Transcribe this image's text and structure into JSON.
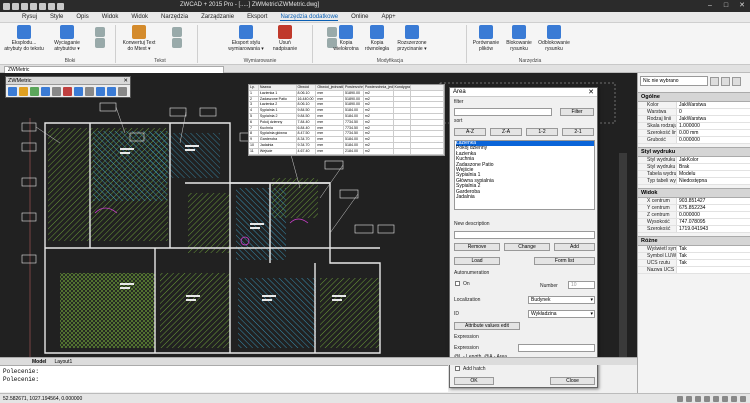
{
  "title_bar": {
    "text": "ZWCAD + 2015 Pro - [.....] ZWMetric\\ZWMetric.dwg]"
  },
  "menu": [
    "Rysuj",
    "Style",
    "Opis",
    "Widok",
    "Widok",
    "Narzędzia",
    "Zarządzanie",
    "Eksport",
    "Narzędzia dodatkowe",
    "Online",
    "App+"
  ],
  "menu_active_index": 8,
  "ribbon": {
    "buttons": [
      {
        "label": "Eksplodu...\natrybuty do tekstu",
        "color": "#3a7bd5"
      },
      {
        "label": "Wyciąganie\natrybutów ▾",
        "color": "#3a7bd5"
      },
      {
        "label": "Konwertuj Text\ndo Mtext ▾",
        "color": "#d48b2c"
      },
      {
        "label": "Eksport stylu\nwymiarowania ▾",
        "color": "#3a7bd5"
      },
      {
        "label": "Usuń\nnadpisanie",
        "color": "#c0392b"
      },
      {
        "label": "Kopia\nwielokrotna",
        "color": "#3a7bd5"
      },
      {
        "label": "Kopia\nrównoległa",
        "color": "#3a7bd5"
      },
      {
        "label": "Rozszerzone\nprzycinanie ▾",
        "color": "#3a7bd5"
      },
      {
        "label": "Porównanie\nplików",
        "color": "#3a7bd5"
      },
      {
        "label": "Blokowanie\nrysunku",
        "color": "#3a7bd5"
      },
      {
        "label": "Odblokowanie\nrysunku",
        "color": "#3a7bd5"
      }
    ],
    "groups": [
      "Bloki",
      "Tekst",
      "Wymiarowanie",
      "Modyfikacja",
      "Narzędzia"
    ]
  },
  "doc_tab": "ZWMetric",
  "zwmetric_title": "ZWMetric",
  "layout_tabs": [
    "Model",
    "Layout1"
  ],
  "command_line": [
    "Polecenie:",
    "Polecenie:"
  ],
  "status_coords": "52.582671,  1027.194564, 0.000000",
  "table": {
    "header": [
      "Lp.",
      "Nazwa",
      "Obwód",
      "Obwód_jednostki",
      "Powierzchnia",
      "Powierzchnia_jednostki",
      "Kondygnacja"
    ],
    "rows": [
      [
        "1",
        "Łazienka 1",
        "8.06.10",
        "mm",
        "51890.00",
        "m2"
      ],
      [
        "2",
        "Zadaszone Patio",
        "16.440.00",
        "mm",
        "51890.00",
        "m2"
      ],
      [
        "3",
        "Łazienka 2",
        "8.06.10",
        "mm",
        "51890.00",
        "m2"
      ],
      [
        "4",
        "Sypialnia 1",
        "9.84.50",
        "mm",
        "5184.00",
        "m2"
      ],
      [
        "5",
        "Sypialnia 2",
        "9.84.50",
        "mm",
        "5184.00",
        "m2"
      ],
      [
        "6",
        "Pokój dzienny",
        "7.84.40",
        "mm",
        "7734.50",
        "m2"
      ],
      [
        "7",
        "Kuchnia",
        "6.84.40",
        "mm",
        "7734.50",
        "m2"
      ],
      [
        "8",
        "Sypialnia główna",
        "8.47.50",
        "mm",
        "7734.50",
        "m2"
      ],
      [
        "9",
        "Garderoba",
        "8.34.70",
        "mm",
        "5184.00",
        "m2"
      ],
      [
        "10",
        "Jadalnia",
        "9.34.70",
        "mm",
        "5184.00",
        "m2"
      ],
      [
        "11",
        "Wejście",
        "4.67.40",
        "mm",
        "2184.00",
        "m2"
      ],
      [
        "12",
        "Korytarz",
        "6.96.00",
        "mm",
        "2184.00",
        "m2"
      ]
    ]
  },
  "area_dialog": {
    "title": "Area",
    "filter_label": "filter",
    "filter_button": "Filter",
    "sort_label": "sort",
    "sort_buttons": [
      "A-Z",
      "Z-A",
      "1-2",
      "2-1"
    ],
    "rooms": [
      "Łazienka",
      "Pokój dzienny",
      "Łazienka",
      "Kuchnia",
      "Zadaszone Patio",
      "Wejście",
      "Sypialnia 1",
      "Główna sypialnia",
      "Sypialnia 2",
      "Garderoba",
      "Jadalnia"
    ],
    "selected_index": 0,
    "new_desc_label": "New description",
    "new_desc_value": "",
    "edit_buttons": [
      "Remove",
      "Change",
      "Add"
    ],
    "load_label": "Load",
    "form_list_label": "Form list",
    "autonumeration_label": "Autonumeration",
    "on_label": "On",
    "number_label": "Number",
    "number_value": "10",
    "localization_label": "Localization",
    "localization_value": "Budynek",
    "id_label": "ID",
    "id_value": "Wykładzina",
    "attr_button": "Attribute values edit",
    "expression_label": "Expression",
    "expression_field_label": "Expression",
    "expression_hint": "@L - Length, @A - Area",
    "add_hatch_label": "Add hatch",
    "ok_label": "OK",
    "close_label": "Close"
  },
  "properties": {
    "dropdown": "Nic nie wybrano",
    "sections": [
      {
        "name": "Ogólne",
        "rows": [
          [
            "Kolor",
            "JakWarstwa"
          ],
          [
            "Warstwa",
            "0"
          ],
          [
            "Rodzaj linii",
            "JakWarstwa"
          ],
          [
            "Skala rodzaju...",
            "1.000000"
          ],
          [
            "Szerokość linii",
            "0.00 mm"
          ],
          [
            "Grubość",
            "0.000000"
          ]
        ]
      },
      {
        "name": "Styl wydruku",
        "rows": [
          [
            "Styl wydruku",
            "JakKolor"
          ],
          [
            "Styl wydruku",
            "Brak"
          ],
          [
            "Tabela wydru...",
            "Modelu"
          ],
          [
            "Typ tabeli wy...",
            "Niedostępna"
          ]
        ]
      },
      {
        "name": "Widok",
        "rows": [
          [
            "X centrum",
            "903.851427"
          ],
          [
            "Y centrum",
            "675.852234"
          ],
          [
            "Z centrum",
            "0.000000"
          ],
          [
            "Wysokość",
            "747.078095"
          ],
          [
            "Szerokość",
            "1719.041943"
          ]
        ]
      },
      {
        "name": "Różne",
        "rows": [
          [
            "Wyświetl sym...",
            "Tak"
          ],
          [
            "Symbol LUW ...",
            "Tak"
          ],
          [
            "UCS rzutu",
            "Tak"
          ],
          [
            "Nazwa UCS",
            ""
          ]
        ]
      }
    ]
  },
  "colors": {
    "canvas_bg": "#212121",
    "wall": "#e8e8e8",
    "hatch_green": "#7fbf3f",
    "hatch_blue": "#3aa0c8",
    "dialog_select": "#0a64d8"
  }
}
